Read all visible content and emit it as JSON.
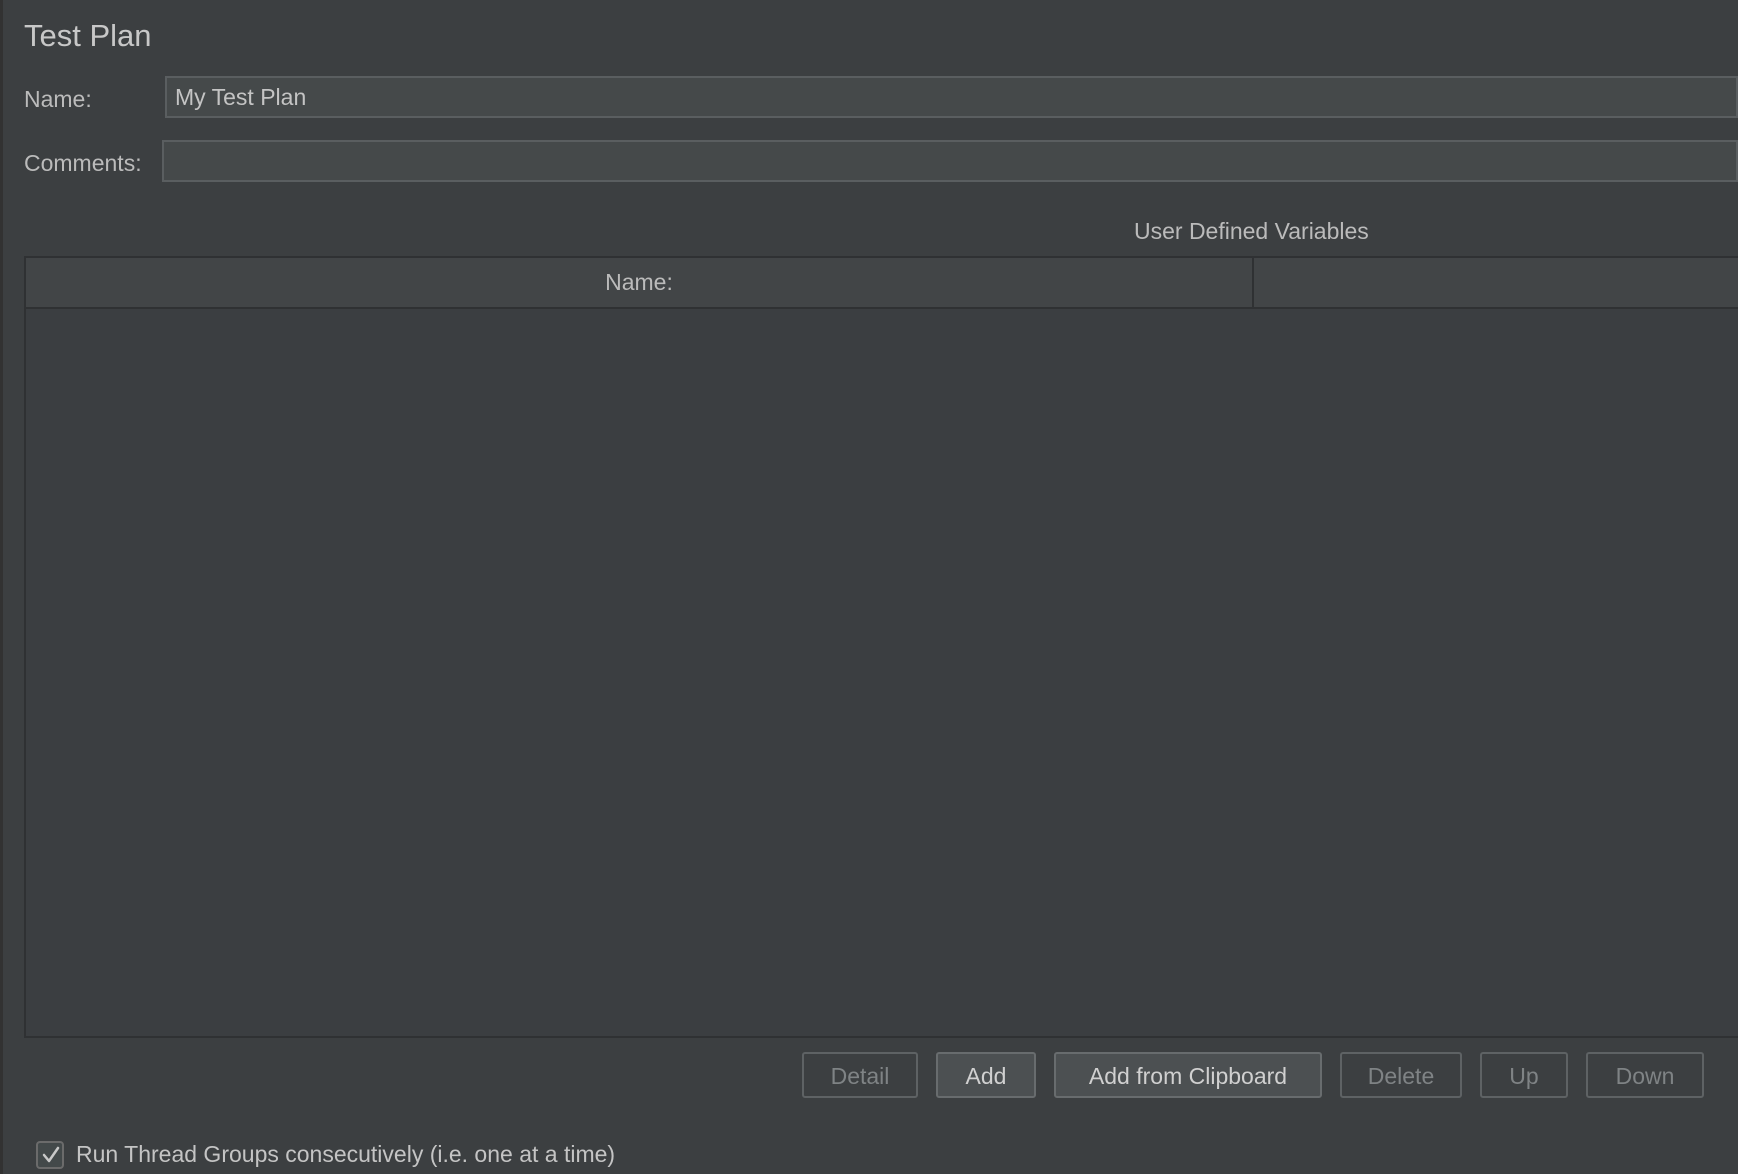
{
  "panel": {
    "title": "Test Plan",
    "name_label": "Name:",
    "name_value": "My Test Plan",
    "comments_label": "Comments:",
    "comments_value": ""
  },
  "variables": {
    "section_title": "User Defined Variables",
    "columns": [
      "Name:",
      ""
    ],
    "rows": []
  },
  "buttons": {
    "detail": "Detail",
    "add": "Add",
    "add_from_clipboard": "Add from Clipboard",
    "delete": "Delete",
    "up": "Up",
    "down": "Down"
  },
  "options": {
    "run_consecutively_label": "Run Thread Groups consecutively (i.e. one at a time)",
    "run_consecutively_checked": true
  },
  "colors": {
    "background": "#3c3f41",
    "text": "#bbbbbb",
    "field": "#45494a"
  },
  "icons": {
    "checkbox": "checkmark-icon"
  }
}
